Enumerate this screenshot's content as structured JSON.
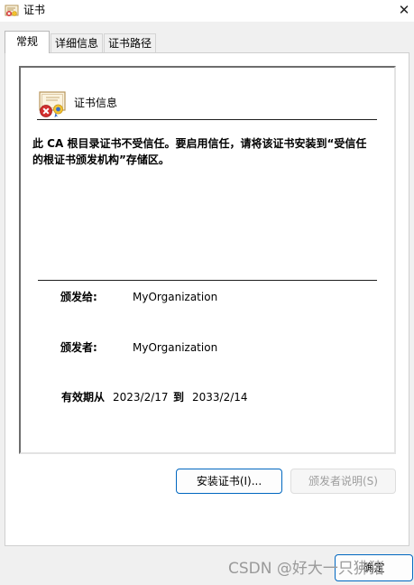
{
  "window": {
    "title": "证书",
    "close_glyph": "✕"
  },
  "tabs": [
    {
      "label": "常规",
      "active": true
    },
    {
      "label": "详细信息",
      "active": false
    },
    {
      "label": "证书路径",
      "active": false
    }
  ],
  "general": {
    "heading": "证书信息",
    "warning": "此 CA 根目录证书不受信任。要启用信任，请将该证书安装到“受信任的根证书颁发机构”存储区。",
    "issued_to_label": "颁发给:",
    "issued_to_value": "MyOrganization",
    "issued_by_label": "颁发者:",
    "issued_by_value": "MyOrganization",
    "valid_label": "有效期从",
    "valid_from": "2023/2/17",
    "valid_to_label": "到",
    "valid_to": "2033/2/14"
  },
  "buttons": {
    "install": "安装证书(I)...",
    "issuer_statement": "颁发者说明(S)",
    "ok": "确定"
  },
  "watermark": "CSDN @好大一只狒猪",
  "icons": {
    "title": "certificate-icon",
    "cert": "certificate-error-icon",
    "close": "close-icon"
  },
  "colors": {
    "accent_border": "#0067c0",
    "disabled_text": "#9d9d9d",
    "dialog_bg": "#f0f0f0"
  }
}
